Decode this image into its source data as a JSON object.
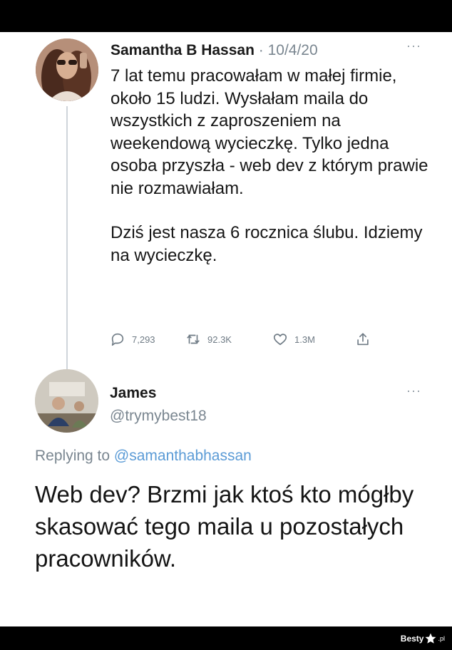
{
  "tweet": {
    "author_name": "Samantha B Hassan",
    "separator": " · ",
    "date": "10/4/20",
    "more_icon": "more-horizontal-icon",
    "paragraph_1": "7 lat temu pracowałam w małej firmie, około 15 ludzi. Wysłałam maila do wszystkich z zaproszeniem na weekendową wycieczkę. Tylko jedna osoba przyszła - web dev z którym prawie nie rozmawiałam.",
    "paragraph_2": "Dziś jest nasza 6 rocznica ślubu. Idziemy na wycieczkę.",
    "actions": {
      "reply_count": "7,293",
      "retweet_count": "92.3K",
      "like_count": "1.3M"
    }
  },
  "reply": {
    "author_name": "James",
    "handle": "@trymybest18",
    "replying_prefix": "Replying to ",
    "replying_mention": "@samanthabhassan",
    "text": "Web dev? Brzmi jak ktoś kto mógłby skasować tego maila u pozostałych pracowników."
  },
  "watermark": {
    "brand": "Besty",
    "tld": ".pl"
  },
  "colors": {
    "text_primary": "#161616",
    "text_secondary": "#7a8690",
    "mention": "#5b9bd6",
    "thread_line": "#cfd5da",
    "background": "#ffffff",
    "frame": "#000000"
  }
}
